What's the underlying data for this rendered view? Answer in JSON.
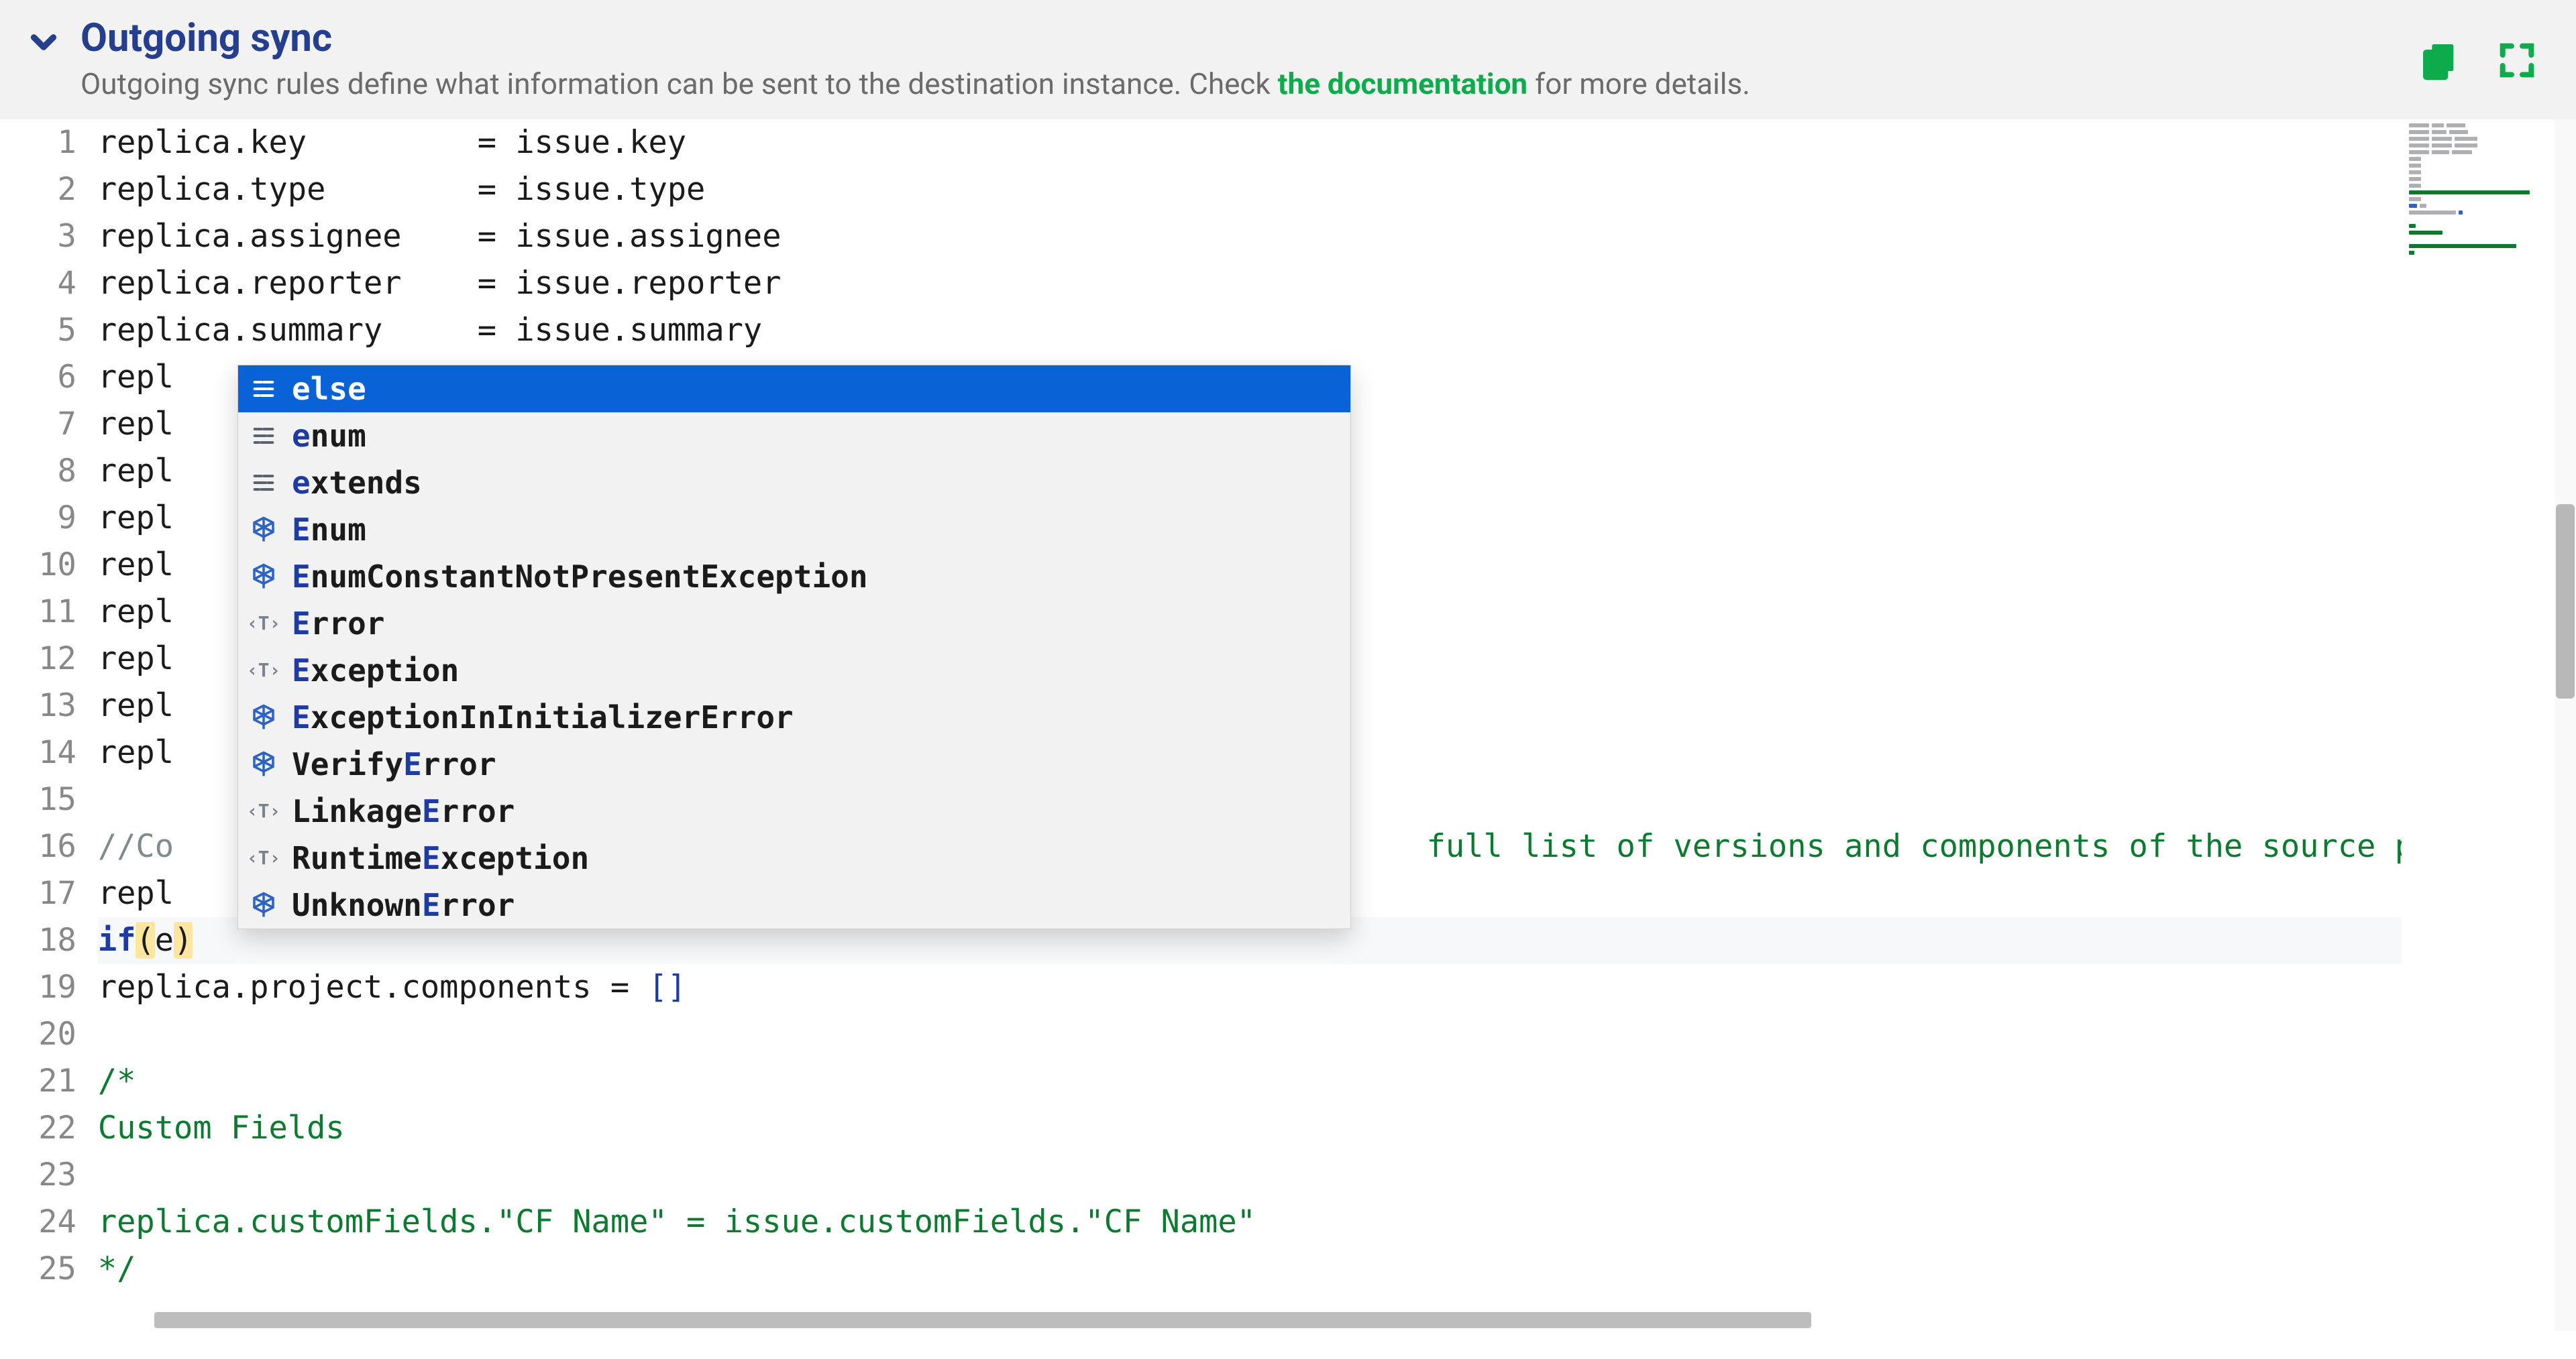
{
  "header": {
    "title": "Outgoing sync",
    "subtitle_prefix": "Outgoing sync rules define what information can be sent to the destination instance. Check ",
    "doc_link_text": "the documentation",
    "subtitle_suffix": " for more details."
  },
  "editor": {
    "first_line_number": 1,
    "lines": [
      {
        "segments": [
          {
            "t": "replica",
            "k": "plain"
          },
          {
            "t": ".",
            "k": "plain"
          },
          {
            "t": "key",
            "k": "plain"
          },
          {
            "t": "         = ",
            "k": "plain"
          },
          {
            "t": "issue",
            "k": "plain"
          },
          {
            "t": ".",
            "k": "plain"
          },
          {
            "t": "key",
            "k": "plain"
          }
        ]
      },
      {
        "segments": [
          {
            "t": "replica",
            "k": "plain"
          },
          {
            "t": ".",
            "k": "plain"
          },
          {
            "t": "type",
            "k": "plain"
          },
          {
            "t": "        = ",
            "k": "plain"
          },
          {
            "t": "issue",
            "k": "plain"
          },
          {
            "t": ".",
            "k": "plain"
          },
          {
            "t": "type",
            "k": "plain"
          }
        ]
      },
      {
        "segments": [
          {
            "t": "replica",
            "k": "plain"
          },
          {
            "t": ".",
            "k": "plain"
          },
          {
            "t": "assignee",
            "k": "plain"
          },
          {
            "t": "    = ",
            "k": "plain"
          },
          {
            "t": "issue",
            "k": "plain"
          },
          {
            "t": ".",
            "k": "plain"
          },
          {
            "t": "assignee",
            "k": "plain"
          }
        ]
      },
      {
        "segments": [
          {
            "t": "replica",
            "k": "plain"
          },
          {
            "t": ".",
            "k": "plain"
          },
          {
            "t": "reporter",
            "k": "plain"
          },
          {
            "t": "    = ",
            "k": "plain"
          },
          {
            "t": "issue",
            "k": "plain"
          },
          {
            "t": ".",
            "k": "plain"
          },
          {
            "t": "reporter",
            "k": "plain"
          }
        ]
      },
      {
        "segments": [
          {
            "t": "replica",
            "k": "plain"
          },
          {
            "t": ".",
            "k": "plain"
          },
          {
            "t": "summary",
            "k": "plain"
          },
          {
            "t": "     = ",
            "k": "plain"
          },
          {
            "t": "issue",
            "k": "plain"
          },
          {
            "t": ".",
            "k": "plain"
          },
          {
            "t": "summary",
            "k": "plain"
          }
        ]
      },
      {
        "segments": [
          {
            "t": "repl",
            "k": "plain"
          }
        ]
      },
      {
        "segments": [
          {
            "t": "repl",
            "k": "plain"
          }
        ]
      },
      {
        "segments": [
          {
            "t": "repl",
            "k": "plain"
          }
        ]
      },
      {
        "segments": [
          {
            "t": "repl",
            "k": "plain"
          }
        ]
      },
      {
        "segments": [
          {
            "t": "repl",
            "k": "plain"
          }
        ]
      },
      {
        "segments": [
          {
            "t": "repl",
            "k": "plain"
          }
        ]
      },
      {
        "segments": [
          {
            "t": "repl",
            "k": "plain"
          }
        ]
      },
      {
        "segments": [
          {
            "t": "repl",
            "k": "plain"
          }
        ]
      },
      {
        "segments": [
          {
            "t": "repl",
            "k": "plain"
          }
        ]
      },
      {
        "segments": []
      },
      {
        "segments": [
          {
            "t": "//Co",
            "k": "comment2"
          },
          {
            "t": "                                                                  ",
            "k": "plain"
          },
          {
            "t": "full list of versions and components of the source proje",
            "k": "green"
          }
        ]
      },
      {
        "segments": [
          {
            "t": "repl",
            "k": "plain"
          }
        ]
      },
      {
        "current": true,
        "segments": [
          {
            "t": "if",
            "k": "kw"
          },
          {
            "t": "(",
            "k": "parens"
          },
          {
            "t": "e",
            "k": "plain"
          },
          {
            "t": ")",
            "k": "parens"
          }
        ]
      },
      {
        "segments": [
          {
            "t": "replica",
            "k": "plain"
          },
          {
            "t": ".",
            "k": "plain"
          },
          {
            "t": "project",
            "k": "plain"
          },
          {
            "t": ".",
            "k": "plain"
          },
          {
            "t": "components",
            "k": "plain"
          },
          {
            "t": " = ",
            "k": "plain"
          },
          {
            "t": "[]",
            "k": "brack"
          }
        ]
      },
      {
        "segments": []
      },
      {
        "segments": [
          {
            "t": "/*",
            "k": "green"
          }
        ]
      },
      {
        "segments": [
          {
            "t": "Custom Fields",
            "k": "green"
          }
        ]
      },
      {
        "segments": []
      },
      {
        "segments": [
          {
            "t": "replica.customFields.",
            "k": "green"
          },
          {
            "t": "\"CF Name\"",
            "k": "green"
          },
          {
            "t": " = issue.customFields.",
            "k": "green"
          },
          {
            "t": "\"CF Name\"",
            "k": "green"
          }
        ]
      },
      {
        "segments": [
          {
            "t": "*/",
            "k": "green"
          }
        ]
      }
    ]
  },
  "autocomplete": {
    "selected_index": 0,
    "items": [
      {
        "icon": "kw",
        "label": "else",
        "match_until": 1
      },
      {
        "icon": "kw",
        "label": "enum",
        "match_until": 1
      },
      {
        "icon": "kw",
        "label": "extends",
        "match_until": 1
      },
      {
        "icon": "hex",
        "label": "Enum",
        "match": [
          0
        ]
      },
      {
        "icon": "hex",
        "label": "EnumConstantNotPresentException",
        "match": [
          0
        ]
      },
      {
        "icon": "t",
        "label": "Error",
        "match": [
          0
        ]
      },
      {
        "icon": "t",
        "label": "Exception",
        "match": [
          0
        ]
      },
      {
        "icon": "hex",
        "label": "ExceptionInInitializerError",
        "match": [
          0
        ]
      },
      {
        "icon": "hex",
        "label": "VerifyError",
        "match": [
          6
        ]
      },
      {
        "icon": "t",
        "label": "LinkageError",
        "match": [
          7
        ]
      },
      {
        "icon": "t",
        "label": "RuntimeException",
        "match": [
          7
        ]
      },
      {
        "icon": "hex",
        "label": "UnknownError",
        "match": [
          7
        ]
      }
    ]
  }
}
